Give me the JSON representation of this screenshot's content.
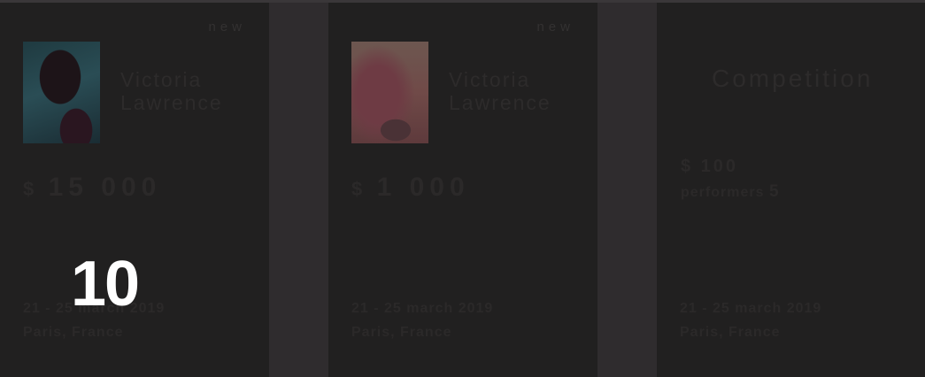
{
  "cards": [
    {
      "badge": "new",
      "name_first": "Victoria",
      "name_last": "Lawrence",
      "currency": "$",
      "amount": "15 000",
      "date": "21 - 25 march 2019",
      "place": "Paris, France"
    },
    {
      "badge": "new",
      "name_first": "Victoria",
      "name_last": "Lawrence",
      "currency": "$",
      "amount": "1 000",
      "date": "21 - 25 march 2019",
      "place": "Paris, France"
    }
  ],
  "competition": {
    "title": "Competition",
    "fee": "$ 100",
    "performers_label": "performers",
    "performers_count": "5",
    "date": "21 - 25 march 2019",
    "place": "Paris, France"
  },
  "overlay": {
    "number": "10"
  },
  "colors": {
    "page_bg": "#2f2c2e",
    "card_bg": "#212020",
    "dim_text": "#2d2b2b",
    "overlay_text": "#ffffff"
  }
}
